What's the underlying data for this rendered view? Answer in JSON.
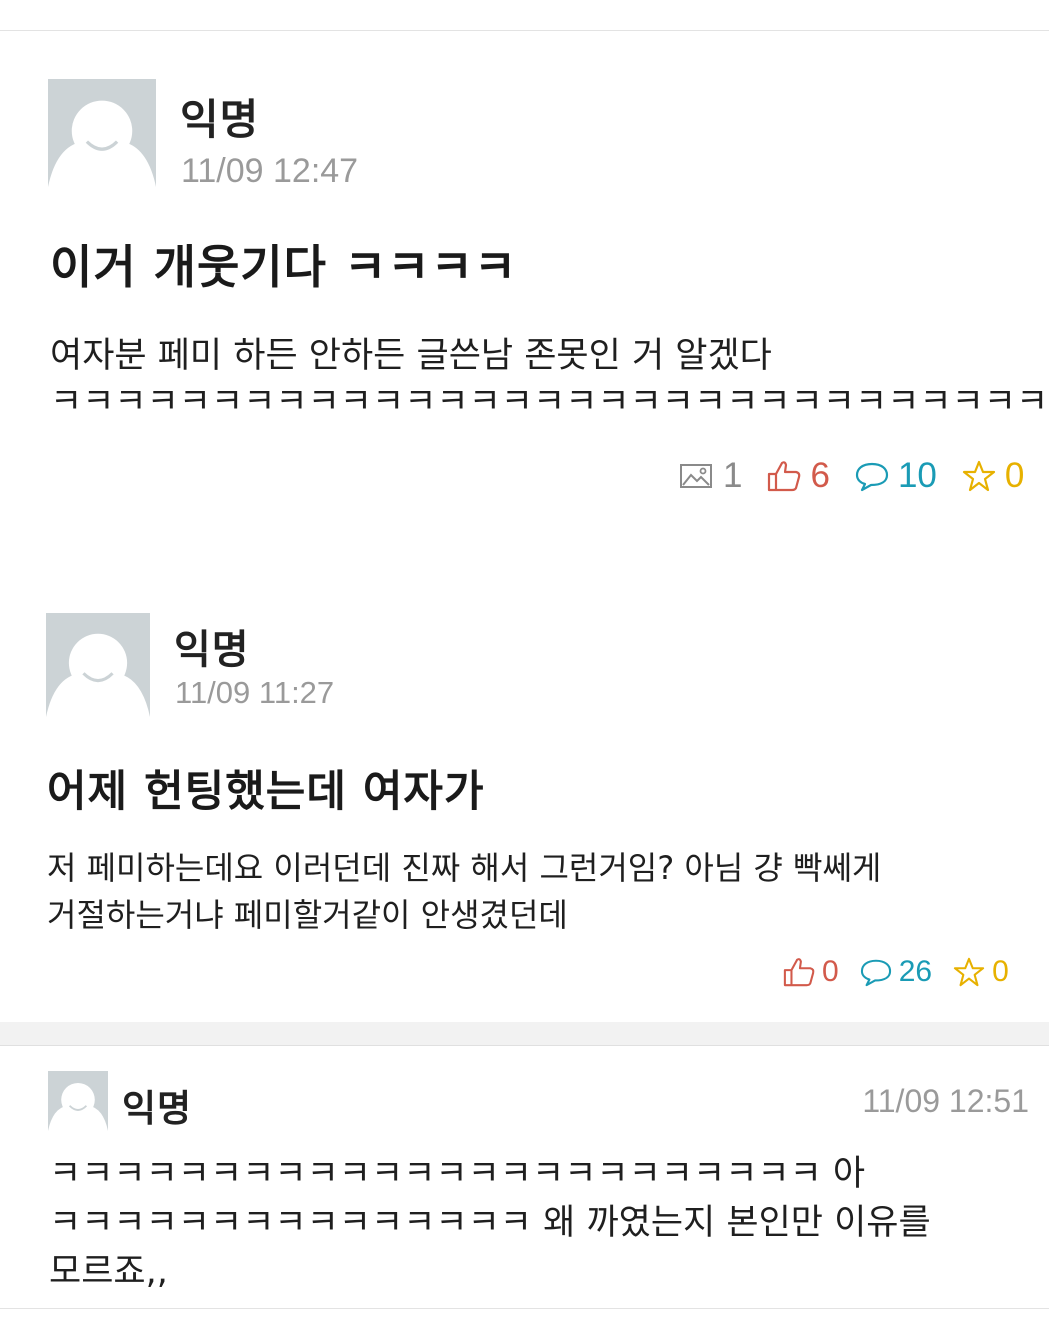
{
  "posts": [
    {
      "author": "익명",
      "time": "11/09 12:47",
      "title": "이거 개웃기다 ㅋㅋㅋㅋ",
      "body_lines": [
        "여자분 페미 하든 안하든 글쓴남 존못인 거 알겠다",
        "ㅋㅋㅋㅋㅋㅋㅋㅋㅋㅋㅋㅋㅋㅋㅋㅋㅋㅋㅋㅋㅋㅋㅋㅋㅋㅋㅋㅋㅋㅋㅋㅋ"
      ],
      "stats": {
        "images": "1",
        "likes": "6",
        "comments": "10",
        "scraps": "0"
      }
    },
    {
      "author": "익명",
      "time": "11/09 11:27",
      "title": "어제 헌팅했는데 여자가",
      "body_lines": [
        "저 페미하는데요 이러던데 진짜 해서 그런거임? 아님 걍 빡쎄게",
        "거절하는거냐 페미할거같이 안생겼던데"
      ],
      "stats": {
        "likes": "0",
        "comments": "26",
        "scraps": "0"
      }
    }
  ],
  "comment": {
    "author": "익명",
    "time": "11/09 12:51",
    "lines": [
      "ㅋㅋㅋㅋㅋㅋㅋㅋㅋㅋㅋㅋㅋㅋㅋㅋㅋㅋㅋㅋㅋㅋㅋㅋ 아",
      "ㅋㅋㅋㅋㅋㅋㅋㅋㅋㅋㅋㅋㅋㅋㅋ 왜 까였는지 본인만 이유를",
      "모르죠,,"
    ]
  },
  "icons": {
    "image": "image-icon",
    "like": "thumbs-up-icon",
    "comment": "comment-bubble-icon",
    "scrap": "star-icon",
    "avatar": "default-avatar-icon"
  },
  "colors": {
    "like": "#d25a4b",
    "comment": "#1a9bb5",
    "scrap": "#e7b100",
    "image": "#8a8a8a",
    "avatar_bg": "#ccd3d6"
  }
}
